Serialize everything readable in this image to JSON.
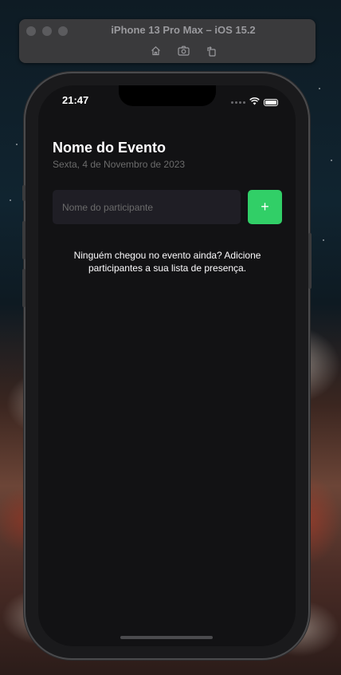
{
  "simulator": {
    "title": "iPhone 13 Pro Max – iOS 15.2",
    "tools": [
      "home-icon",
      "screenshot-icon",
      "rotate-icon"
    ]
  },
  "status_bar": {
    "time": "21:47"
  },
  "event": {
    "title": "Nome do Evento",
    "date": "Sexta, 4 de Novembro de 2023"
  },
  "form": {
    "input_placeholder": "Nome do participante",
    "input_value": "",
    "add_label": "+"
  },
  "empty_message": "Ninguém chegou no evento ainda? Adicione participantes a sua lista de presença.",
  "colors": {
    "background": "#121214",
    "input_bg": "#1f1e25",
    "accent": "#31cf67",
    "text": "#fdfcfe",
    "muted": "#6b6b6b"
  }
}
